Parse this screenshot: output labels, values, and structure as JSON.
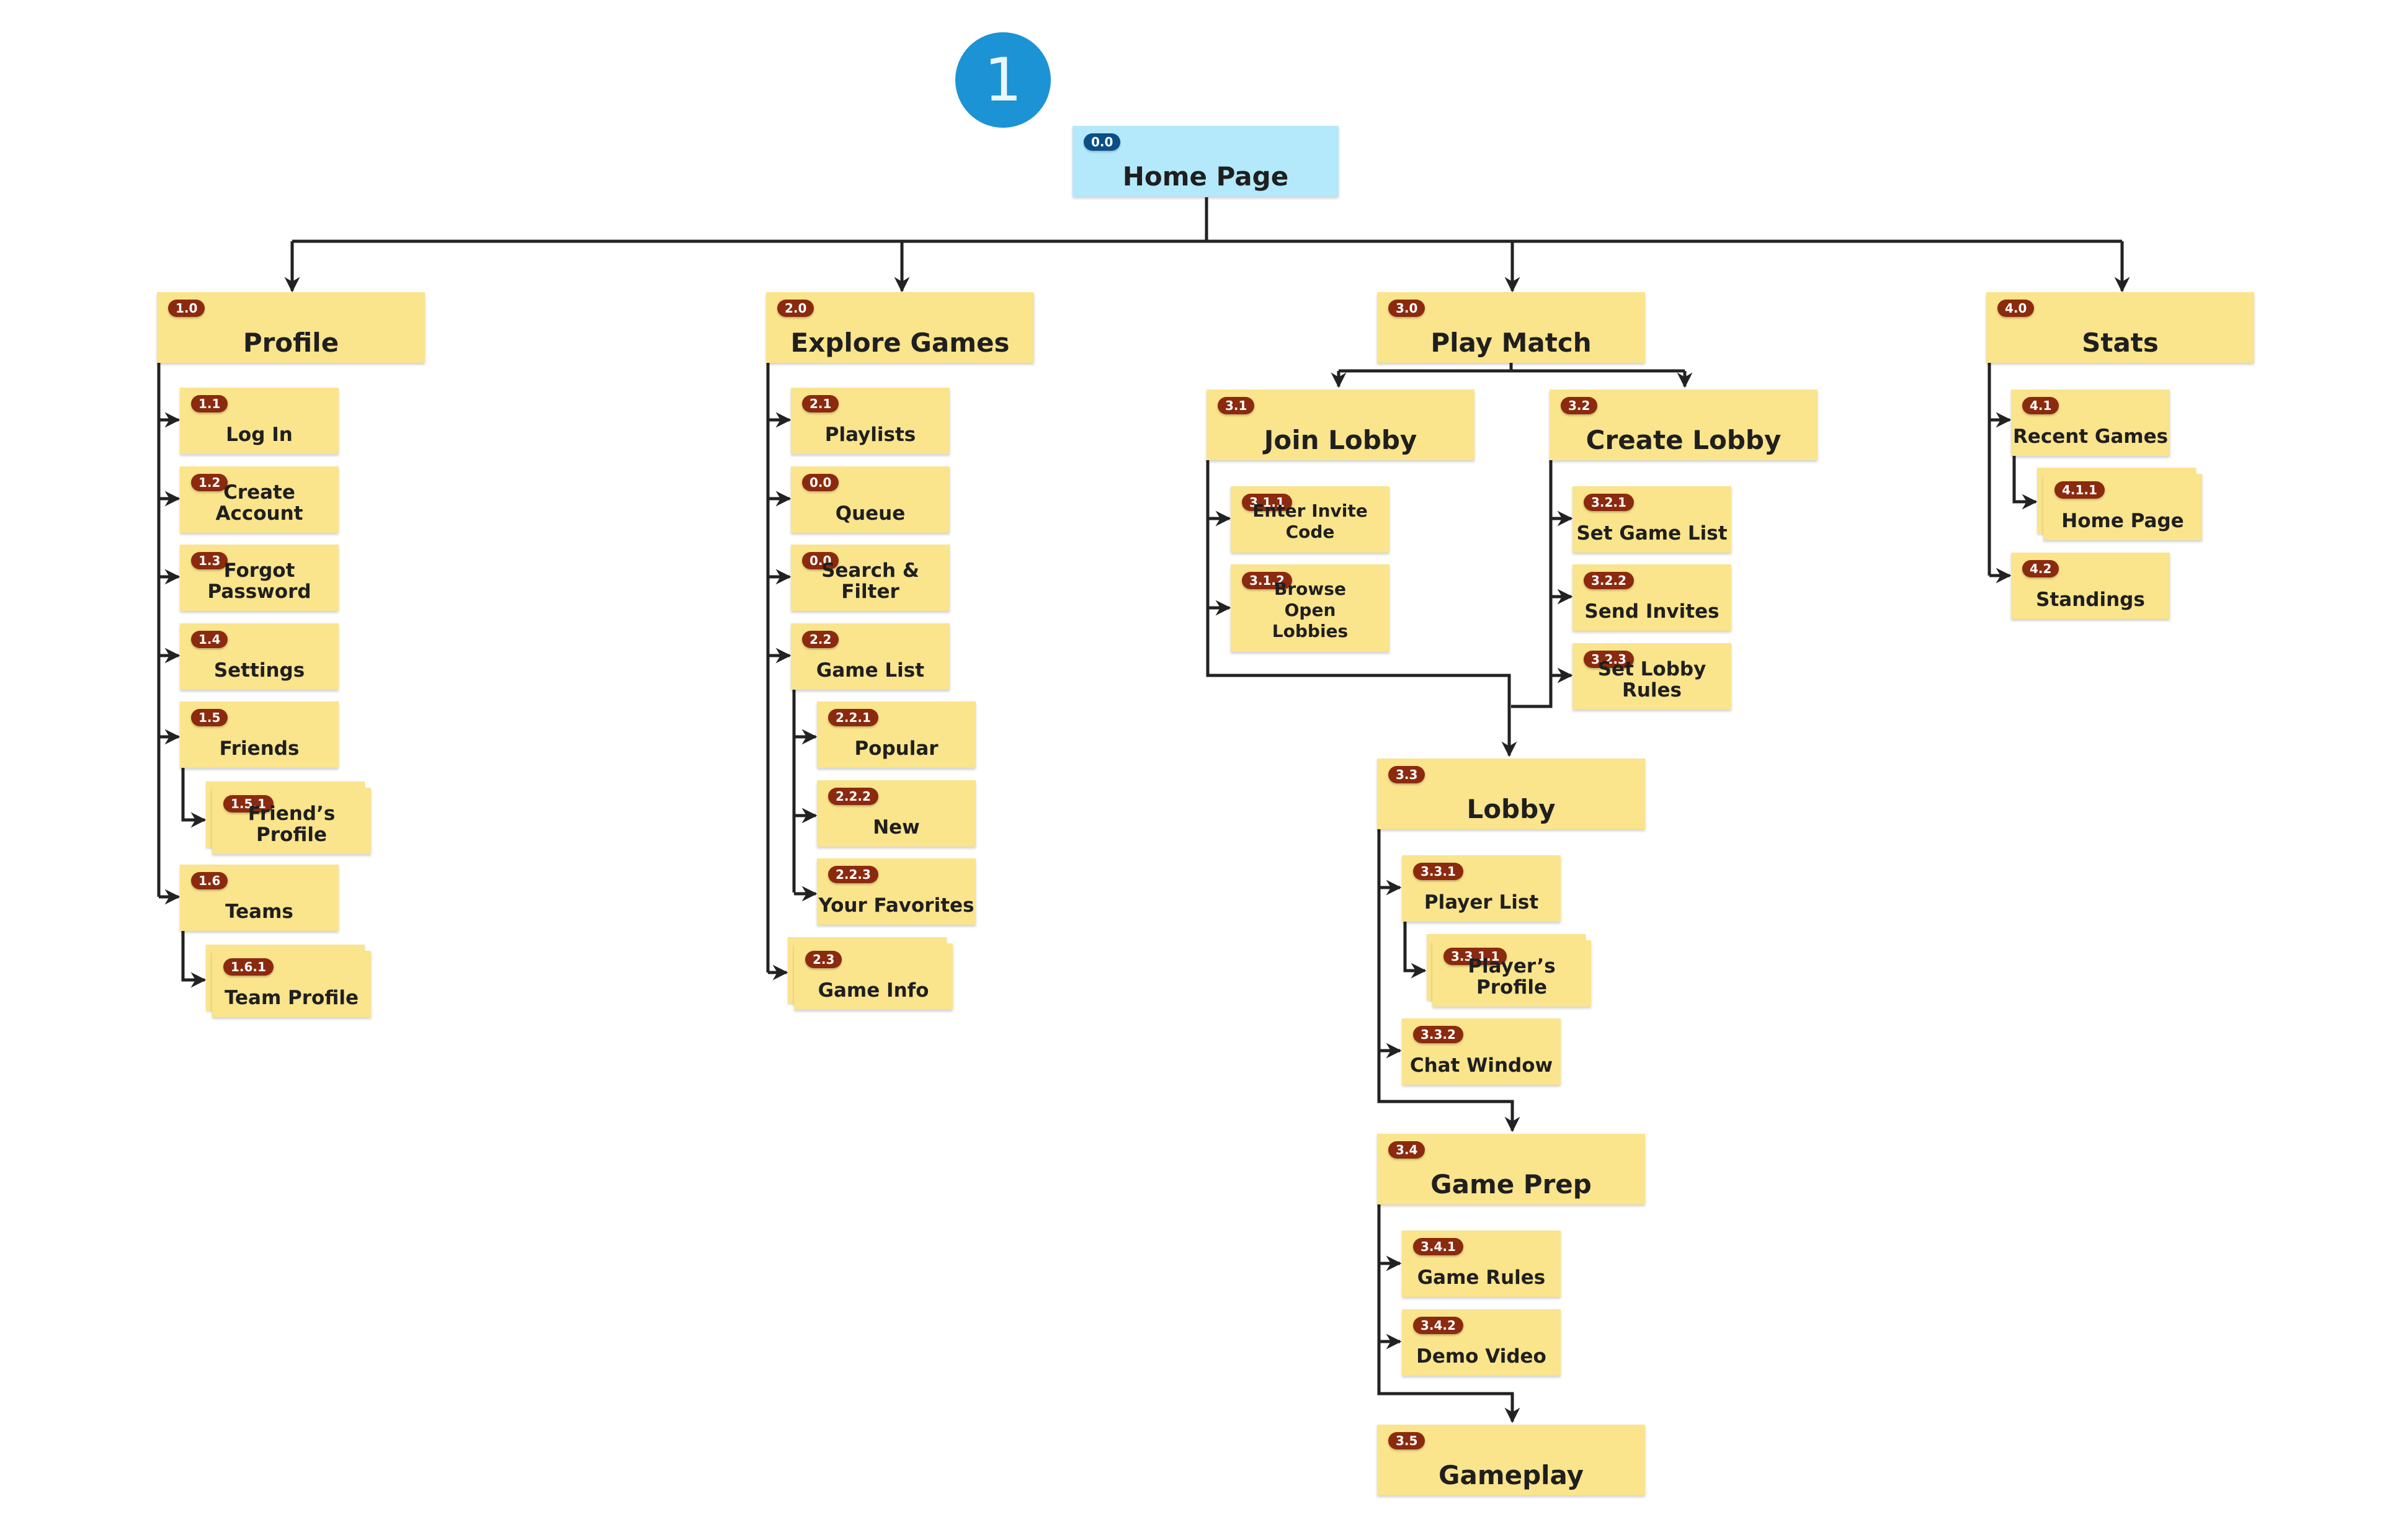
{
  "step_marker": "1",
  "colors": {
    "root_fill": "#b3e9fb",
    "node_fill": "#fae48c",
    "badge_fill": "#8b2a0e",
    "root_badge_fill": "#0a4f86",
    "step_circle": "#1c93d4",
    "connector": "#222222"
  },
  "root": {
    "id": "0.0",
    "label": "Home Page"
  },
  "sections": [
    {
      "id": "1.0",
      "label": "Profile",
      "children": [
        {
          "id": "1.1",
          "label": "Log In"
        },
        {
          "id": "1.2",
          "label": "Create Account"
        },
        {
          "id": "1.3",
          "label": "Forgot Password"
        },
        {
          "id": "1.4",
          "label": "Settings"
        },
        {
          "id": "1.5",
          "label": "Friends",
          "children": [
            {
              "id": "1.5.1",
              "label": "Friend’s Profile",
              "stacked": true
            }
          ]
        },
        {
          "id": "1.6",
          "label": "Teams",
          "children": [
            {
              "id": "1.6.1",
              "label": "Team Profile",
              "stacked": true
            }
          ]
        }
      ]
    },
    {
      "id": "2.0",
      "label": "Explore Games",
      "children": [
        {
          "id": "2.1",
          "label": "Playlists"
        },
        {
          "id": "0.0",
          "label": "Queue"
        },
        {
          "id": "0.0",
          "label": "Search & Filter"
        },
        {
          "id": "2.2",
          "label": "Game List",
          "children": [
            {
              "id": "2.2.1",
              "label": "Popular"
            },
            {
              "id": "2.2.2",
              "label": "New"
            },
            {
              "id": "2.2.3",
              "label": "Your Favorites"
            }
          ]
        },
        {
          "id": "2.3",
          "label": "Game Info",
          "stacked": true
        }
      ]
    },
    {
      "id": "3.0",
      "label": "Play Match",
      "branches": [
        {
          "id": "3.1",
          "label": "Join Lobby",
          "children": [
            {
              "id": "3.1.1",
              "label": "Enter Invite Code"
            },
            {
              "id": "3.1.2",
              "label": "Browse Open Lobbies"
            }
          ]
        },
        {
          "id": "3.2",
          "label": "Create Lobby",
          "children": [
            {
              "id": "3.2.1",
              "label": "Set Game List"
            },
            {
              "id": "3.2.2",
              "label": "Send Invites"
            },
            {
              "id": "3.2.3",
              "label": "Set Lobby Rules"
            }
          ]
        }
      ],
      "flow": [
        {
          "id": "3.3",
          "label": "Lobby",
          "children": [
            {
              "id": "3.3.1",
              "label": "Player List",
              "children": [
                {
                  "id": "3.3.1.1",
                  "label": "Player’s Profile",
                  "stacked": true
                }
              ]
            },
            {
              "id": "3.3.2",
              "label": "Chat Window"
            }
          ]
        },
        {
          "id": "3.4",
          "label": "Game Prep",
          "children": [
            {
              "id": "3.4.1",
              "label": "Game Rules"
            },
            {
              "id": "3.4.2",
              "label": "Demo Video"
            }
          ]
        },
        {
          "id": "3.5",
          "label": "Gameplay"
        }
      ]
    },
    {
      "id": "4.0",
      "label": "Stats",
      "children": [
        {
          "id": "4.1",
          "label": "Recent Games",
          "children": [
            {
              "id": "4.1.1",
              "label": "Home Page",
              "stacked": true
            }
          ]
        },
        {
          "id": "4.2",
          "label": "Standings"
        }
      ]
    }
  ]
}
